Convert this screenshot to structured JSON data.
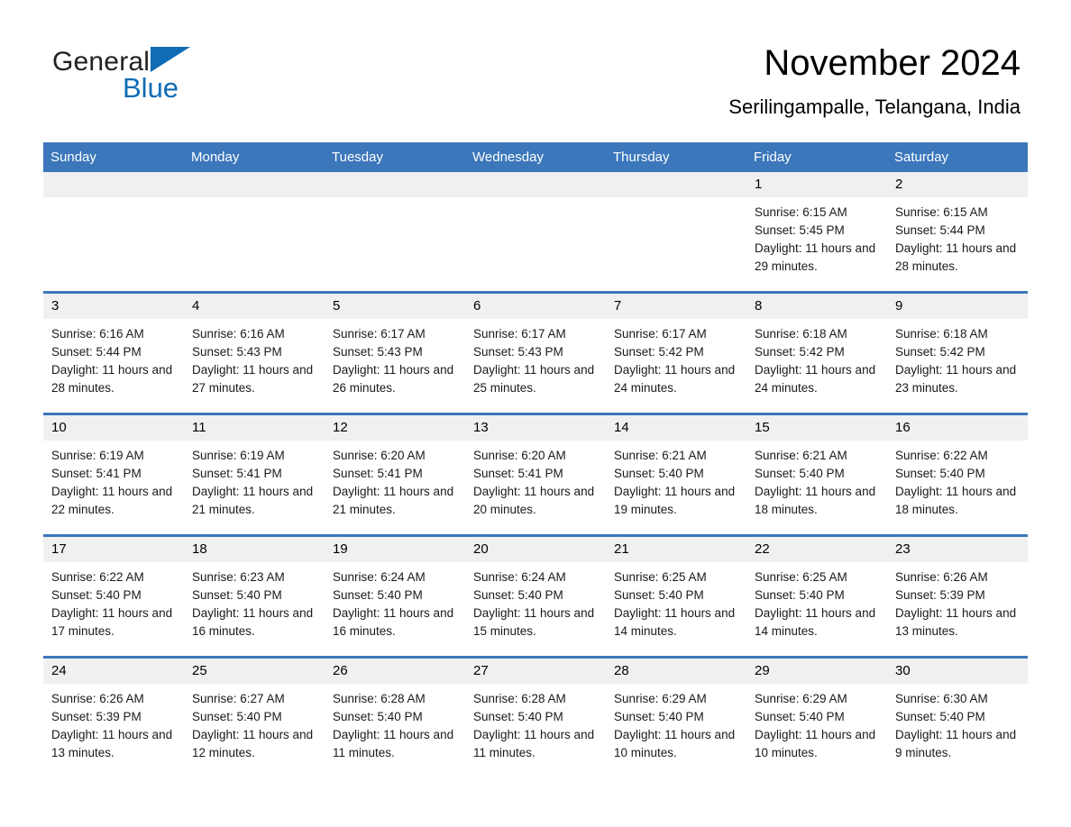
{
  "brand": {
    "name_part1": "General",
    "name_part2": "Blue",
    "triangle_color": "#0f6cb5"
  },
  "header": {
    "title": "November 2024",
    "subtitle": "Serilingampalle, Telangana, India"
  },
  "theme": {
    "header_blue": "#3b77ba",
    "daynum_gray": "#f0f0f0",
    "text_black": "#000000"
  },
  "weekday_headers": [
    "Sunday",
    "Monday",
    "Tuesday",
    "Wednesday",
    "Thursday",
    "Friday",
    "Saturday"
  ],
  "labels": {
    "sunrise_prefix": "Sunrise: ",
    "sunset_prefix": "Sunset: ",
    "daylight_prefix": "Daylight: "
  },
  "weeks": [
    [
      {
        "day": "",
        "sunrise": "",
        "sunset": "",
        "daylight": "",
        "empty": true
      },
      {
        "day": "",
        "sunrise": "",
        "sunset": "",
        "daylight": "",
        "empty": true
      },
      {
        "day": "",
        "sunrise": "",
        "sunset": "",
        "daylight": "",
        "empty": true
      },
      {
        "day": "",
        "sunrise": "",
        "sunset": "",
        "daylight": "",
        "empty": true
      },
      {
        "day": "",
        "sunrise": "",
        "sunset": "",
        "daylight": "",
        "empty": true
      },
      {
        "day": "1",
        "sunrise": "Sunrise: 6:15 AM",
        "sunset": "Sunset: 5:45 PM",
        "daylight": "Daylight: 11 hours and 29 minutes.",
        "empty": false
      },
      {
        "day": "2",
        "sunrise": "Sunrise: 6:15 AM",
        "sunset": "Sunset: 5:44 PM",
        "daylight": "Daylight: 11 hours and 28 minutes.",
        "empty": false
      }
    ],
    [
      {
        "day": "3",
        "sunrise": "Sunrise: 6:16 AM",
        "sunset": "Sunset: 5:44 PM",
        "daylight": "Daylight: 11 hours and 28 minutes.",
        "empty": false
      },
      {
        "day": "4",
        "sunrise": "Sunrise: 6:16 AM",
        "sunset": "Sunset: 5:43 PM",
        "daylight": "Daylight: 11 hours and 27 minutes.",
        "empty": false
      },
      {
        "day": "5",
        "sunrise": "Sunrise: 6:17 AM",
        "sunset": "Sunset: 5:43 PM",
        "daylight": "Daylight: 11 hours and 26 minutes.",
        "empty": false
      },
      {
        "day": "6",
        "sunrise": "Sunrise: 6:17 AM",
        "sunset": "Sunset: 5:43 PM",
        "daylight": "Daylight: 11 hours and 25 minutes.",
        "empty": false
      },
      {
        "day": "7",
        "sunrise": "Sunrise: 6:17 AM",
        "sunset": "Sunset: 5:42 PM",
        "daylight": "Daylight: 11 hours and 24 minutes.",
        "empty": false
      },
      {
        "day": "8",
        "sunrise": "Sunrise: 6:18 AM",
        "sunset": "Sunset: 5:42 PM",
        "daylight": "Daylight: 11 hours and 24 minutes.",
        "empty": false
      },
      {
        "day": "9",
        "sunrise": "Sunrise: 6:18 AM",
        "sunset": "Sunset: 5:42 PM",
        "daylight": "Daylight: 11 hours and 23 minutes.",
        "empty": false
      }
    ],
    [
      {
        "day": "10",
        "sunrise": "Sunrise: 6:19 AM",
        "sunset": "Sunset: 5:41 PM",
        "daylight": "Daylight: 11 hours and 22 minutes.",
        "empty": false
      },
      {
        "day": "11",
        "sunrise": "Sunrise: 6:19 AM",
        "sunset": "Sunset: 5:41 PM",
        "daylight": "Daylight: 11 hours and 21 minutes.",
        "empty": false
      },
      {
        "day": "12",
        "sunrise": "Sunrise: 6:20 AM",
        "sunset": "Sunset: 5:41 PM",
        "daylight": "Daylight: 11 hours and 21 minutes.",
        "empty": false
      },
      {
        "day": "13",
        "sunrise": "Sunrise: 6:20 AM",
        "sunset": "Sunset: 5:41 PM",
        "daylight": "Daylight: 11 hours and 20 minutes.",
        "empty": false
      },
      {
        "day": "14",
        "sunrise": "Sunrise: 6:21 AM",
        "sunset": "Sunset: 5:40 PM",
        "daylight": "Daylight: 11 hours and 19 minutes.",
        "empty": false
      },
      {
        "day": "15",
        "sunrise": "Sunrise: 6:21 AM",
        "sunset": "Sunset: 5:40 PM",
        "daylight": "Daylight: 11 hours and 18 minutes.",
        "empty": false
      },
      {
        "day": "16",
        "sunrise": "Sunrise: 6:22 AM",
        "sunset": "Sunset: 5:40 PM",
        "daylight": "Daylight: 11 hours and 18 minutes.",
        "empty": false
      }
    ],
    [
      {
        "day": "17",
        "sunrise": "Sunrise: 6:22 AM",
        "sunset": "Sunset: 5:40 PM",
        "daylight": "Daylight: 11 hours and 17 minutes.",
        "empty": false
      },
      {
        "day": "18",
        "sunrise": "Sunrise: 6:23 AM",
        "sunset": "Sunset: 5:40 PM",
        "daylight": "Daylight: 11 hours and 16 minutes.",
        "empty": false
      },
      {
        "day": "19",
        "sunrise": "Sunrise: 6:24 AM",
        "sunset": "Sunset: 5:40 PM",
        "daylight": "Daylight: 11 hours and 16 minutes.",
        "empty": false
      },
      {
        "day": "20",
        "sunrise": "Sunrise: 6:24 AM",
        "sunset": "Sunset: 5:40 PM",
        "daylight": "Daylight: 11 hours and 15 minutes.",
        "empty": false
      },
      {
        "day": "21",
        "sunrise": "Sunrise: 6:25 AM",
        "sunset": "Sunset: 5:40 PM",
        "daylight": "Daylight: 11 hours and 14 minutes.",
        "empty": false
      },
      {
        "day": "22",
        "sunrise": "Sunrise: 6:25 AM",
        "sunset": "Sunset: 5:40 PM",
        "daylight": "Daylight: 11 hours and 14 minutes.",
        "empty": false
      },
      {
        "day": "23",
        "sunrise": "Sunrise: 6:26 AM",
        "sunset": "Sunset: 5:39 PM",
        "daylight": "Daylight: 11 hours and 13 minutes.",
        "empty": false
      }
    ],
    [
      {
        "day": "24",
        "sunrise": "Sunrise: 6:26 AM",
        "sunset": "Sunset: 5:39 PM",
        "daylight": "Daylight: 11 hours and 13 minutes.",
        "empty": false
      },
      {
        "day": "25",
        "sunrise": "Sunrise: 6:27 AM",
        "sunset": "Sunset: 5:40 PM",
        "daylight": "Daylight: 11 hours and 12 minutes.",
        "empty": false
      },
      {
        "day": "26",
        "sunrise": "Sunrise: 6:28 AM",
        "sunset": "Sunset: 5:40 PM",
        "daylight": "Daylight: 11 hours and 11 minutes.",
        "empty": false
      },
      {
        "day": "27",
        "sunrise": "Sunrise: 6:28 AM",
        "sunset": "Sunset: 5:40 PM",
        "daylight": "Daylight: 11 hours and 11 minutes.",
        "empty": false
      },
      {
        "day": "28",
        "sunrise": "Sunrise: 6:29 AM",
        "sunset": "Sunset: 5:40 PM",
        "daylight": "Daylight: 11 hours and 10 minutes.",
        "empty": false
      },
      {
        "day": "29",
        "sunrise": "Sunrise: 6:29 AM",
        "sunset": "Sunset: 5:40 PM",
        "daylight": "Daylight: 11 hours and 10 minutes.",
        "empty": false
      },
      {
        "day": "30",
        "sunrise": "Sunrise: 6:30 AM",
        "sunset": "Sunset: 5:40 PM",
        "daylight": "Daylight: 11 hours and 9 minutes.",
        "empty": false
      }
    ]
  ]
}
